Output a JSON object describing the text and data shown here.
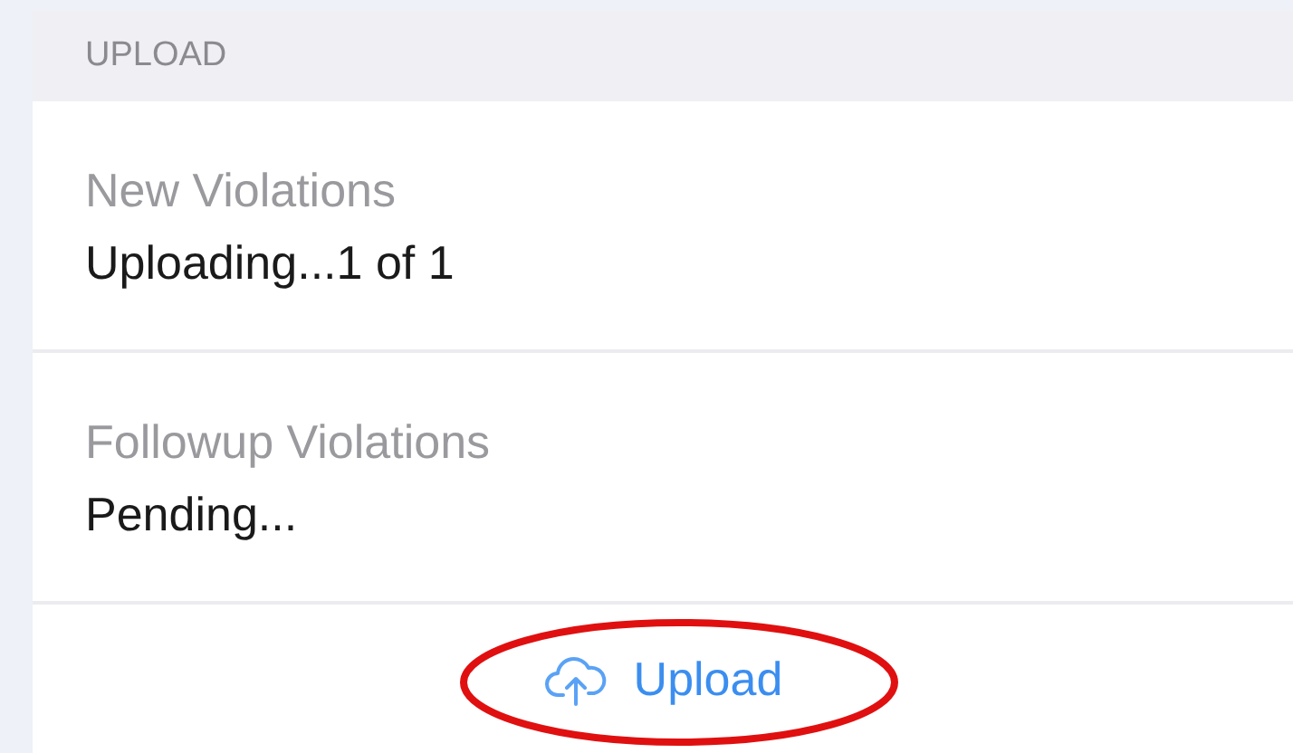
{
  "section": {
    "title": "UPLOAD"
  },
  "rows": [
    {
      "label": "New Violations",
      "status": "Uploading...1 of 1"
    },
    {
      "label": "Followup Violations",
      "status": "Pending..."
    }
  ],
  "upload_button": {
    "label": "Upload"
  }
}
